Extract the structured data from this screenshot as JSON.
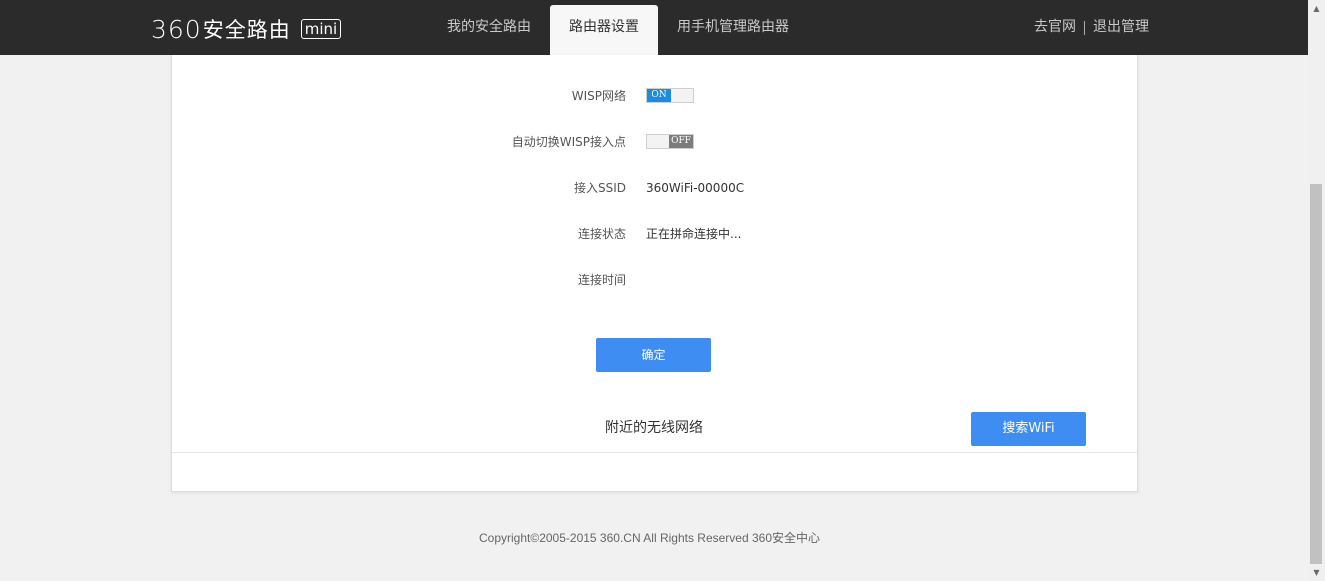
{
  "header": {
    "logo_number": "360",
    "logo_text": "安全路由",
    "logo_badge": "mini",
    "tabs": [
      {
        "label": "我的安全路由",
        "active": false
      },
      {
        "label": "路由器设置",
        "active": true
      },
      {
        "label": "用手机管理路由器",
        "active": false
      }
    ],
    "link_official": "去官网",
    "link_logout": "退出管理"
  },
  "form": {
    "wisp_label": "WISP网络",
    "wisp_state": "ON",
    "auto_switch_label": "自动切换WISP接入点",
    "auto_switch_state": "OFF",
    "ssid_label": "接入SSID",
    "ssid_value": "360WiFi-00000C",
    "status_label": "连接状态",
    "status_value": "正在拼命连接中...",
    "time_label": "连接时间",
    "time_value": "",
    "confirm_button": "确定"
  },
  "nearby": {
    "title": "附近的无线网络",
    "search_button": "搜索WiFi"
  },
  "footer": {
    "copyright": "Copyright©2005-2015 360.CN All Rights Reserved 360安全中心"
  },
  "colors": {
    "topbar": "#2b2b2b",
    "accent": "#3e8df3",
    "toggle_on": "#1a8de0",
    "toggle_off": "#7c7c7c"
  }
}
